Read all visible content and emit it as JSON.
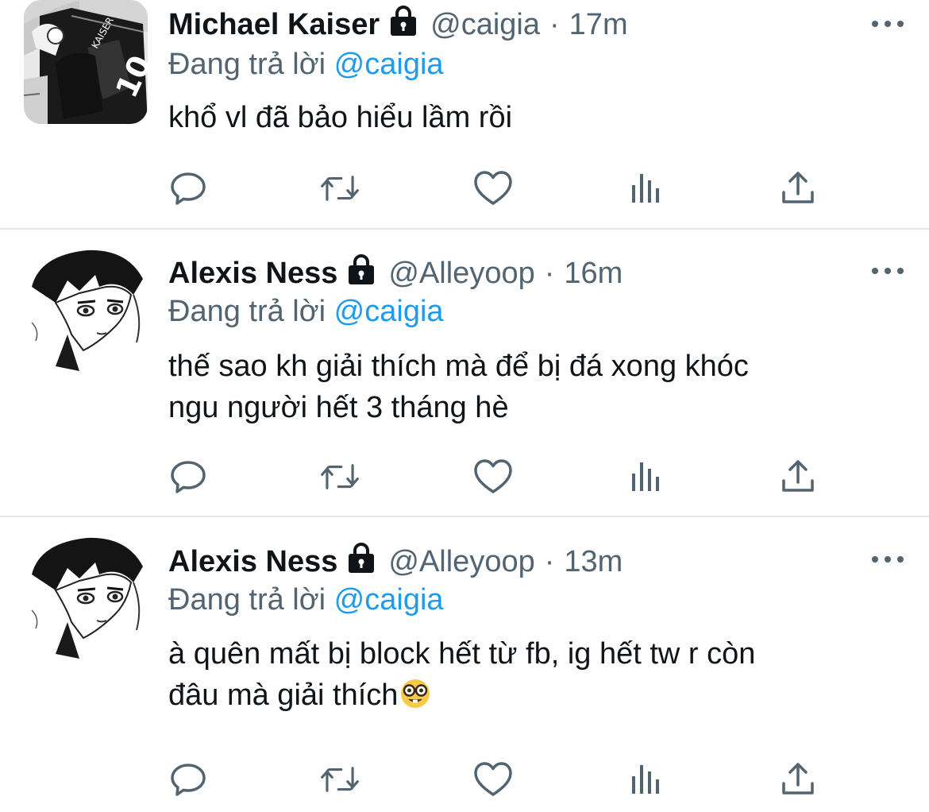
{
  "reply_prefix": "Đang trả lời",
  "tweets": [
    {
      "name": "Michael Kaiser",
      "handle": "@caigia",
      "separator": "·",
      "time": "17m",
      "reply_to": "@caigia",
      "text": "khổ vl đã bảo hiểu lầm rồi",
      "avatar": "kaiser-jersey-avatar"
    },
    {
      "name": "Alexis Ness",
      "handle": "@Alleyoop",
      "separator": "·",
      "time": "16m",
      "reply_to": "@caigia",
      "text_line1": "thế sao kh giải thích mà để bị đá xong khóc",
      "text_line2": "ngu người hết 3 tháng hè",
      "avatar": "ness-manga-avatar"
    },
    {
      "name": "Alexis Ness",
      "handle": "@Alleyoop",
      "separator": "·",
      "time": "13m",
      "reply_to": "@caigia",
      "text_line1": "à quên mất bị block hết từ fb, ig hết tw r còn",
      "text_line2": "đâu mà giải thích",
      "emoji": "nerd-face-emoji",
      "avatar": "ness-manga-avatar"
    }
  ],
  "icons": [
    "reply-icon",
    "retweet-icon",
    "like-icon",
    "views-icon",
    "share-icon",
    "lock-icon",
    "more-icon"
  ],
  "colors": {
    "text": "#0f1419",
    "secondary": "#536471",
    "link": "#1d9bf0",
    "divider": "#e6e9eb"
  }
}
